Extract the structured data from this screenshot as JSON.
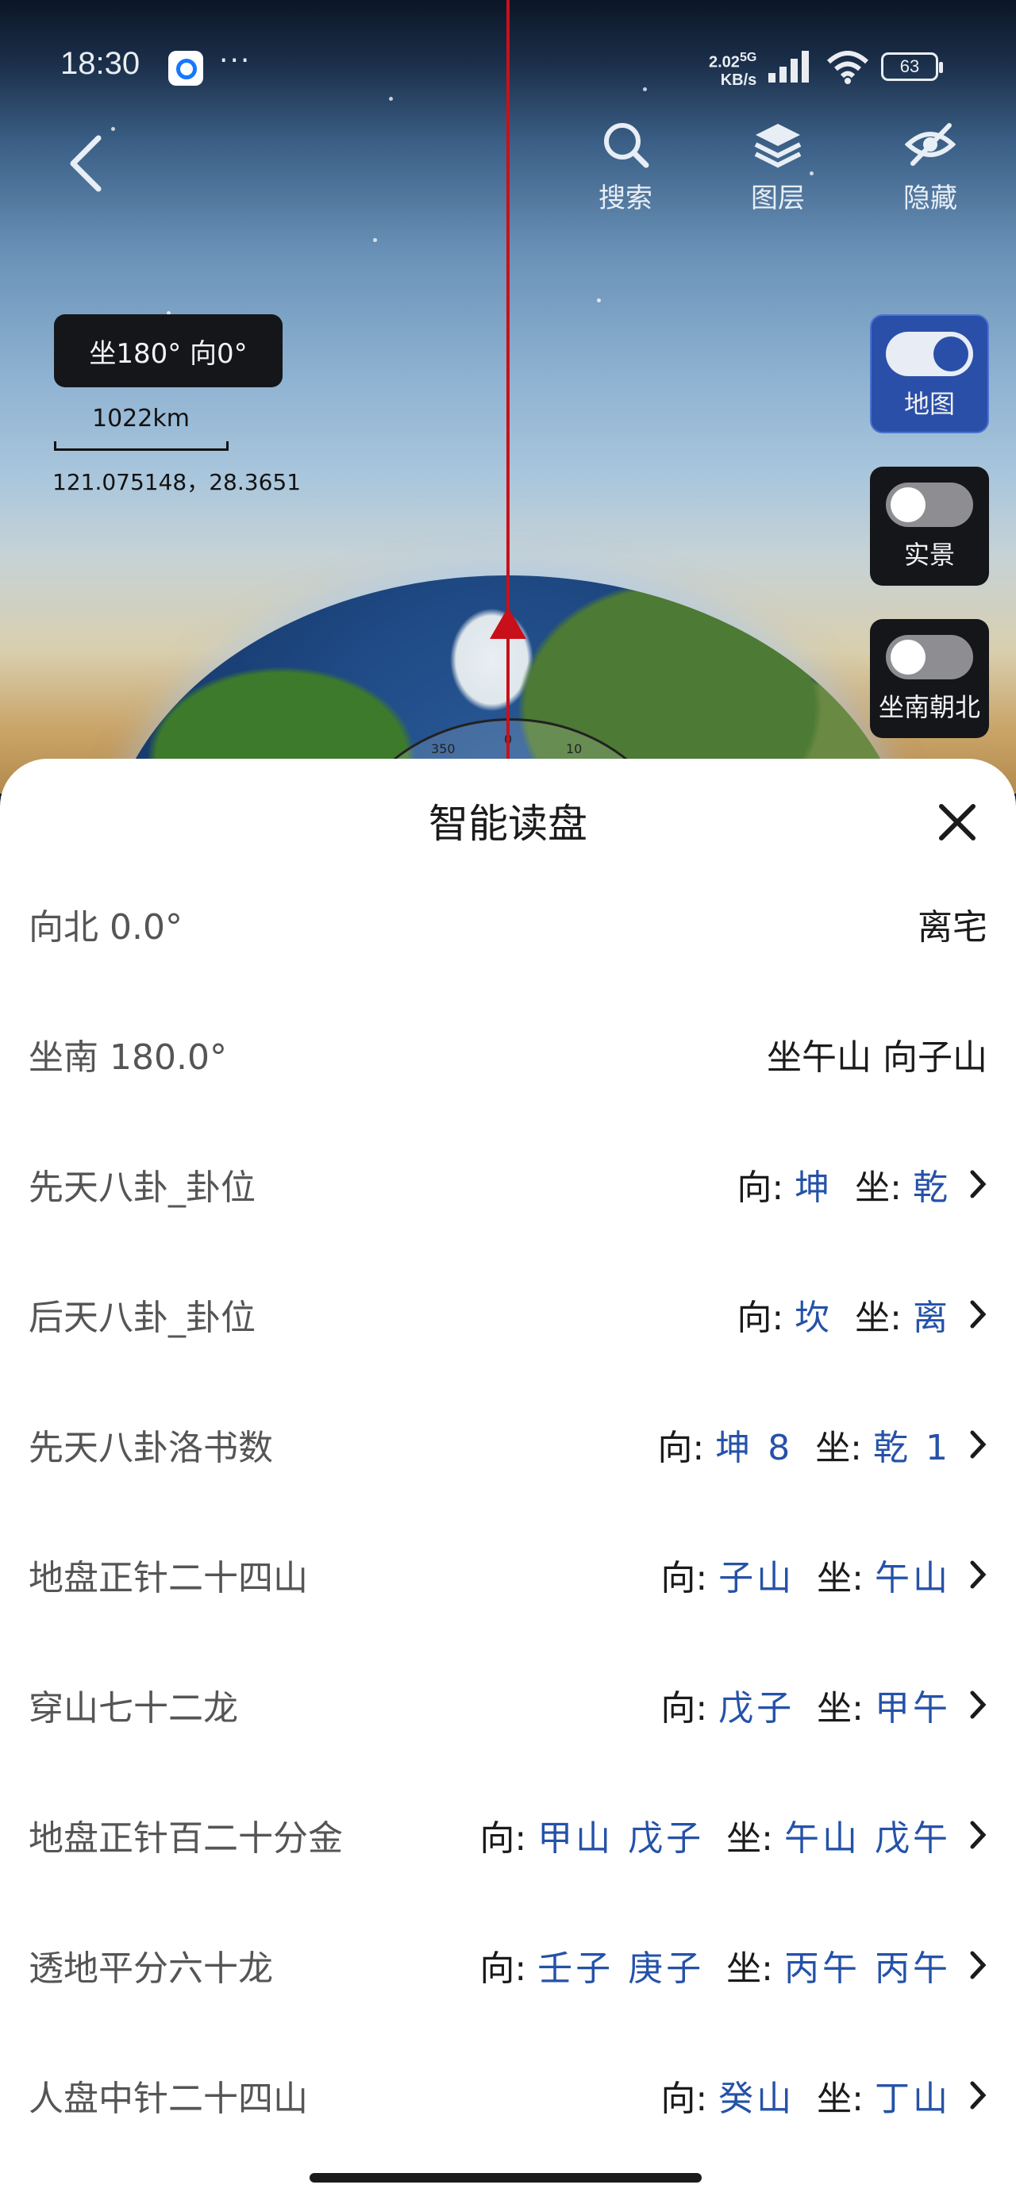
{
  "status_bar": {
    "time": "18:30",
    "net_speed_value": "2.02",
    "net_speed_unit": "KB/s",
    "network": "5G",
    "battery": "63"
  },
  "top_nav": {
    "search_label": "搜索",
    "layers_label": "图层",
    "hide_label": "隐藏"
  },
  "map_overlay": {
    "bearing": "坐180° 向0°",
    "scale": "1022km",
    "coords": "121.075148，28.3651",
    "compass_ticks": [
      "350",
      "0",
      "10"
    ]
  },
  "side_toggles": [
    {
      "label": "地图",
      "on": true
    },
    {
      "label": "实景",
      "on": false
    },
    {
      "label": "坐南朝北",
      "on": false
    }
  ],
  "sheet": {
    "title": "智能读盘",
    "info_rows": [
      {
        "label": "向北  0.0°",
        "value": "离宅"
      },
      {
        "label": "坐南  180.0°",
        "value": "坐午山 向子山"
      }
    ],
    "rows": [
      {
        "label": "先天八卦_卦位",
        "face_key": "向:",
        "face": "坤",
        "sit_key": "坐:",
        "sit": "乾"
      },
      {
        "label": "后天八卦_卦位",
        "face_key": "向:",
        "face": "坎",
        "sit_key": "坐:",
        "sit": "离"
      },
      {
        "label": "先天八卦洛书数",
        "face_key": "向:",
        "face": "坤 8",
        "sit_key": "坐:",
        "sit": "乾 1"
      },
      {
        "label": "地盘正针二十四山",
        "face_key": "向:",
        "face": "子山",
        "sit_key": "坐:",
        "sit": "午山"
      },
      {
        "label": "穿山七十二龙",
        "face_key": "向:",
        "face": "戊子",
        "sit_key": "坐:",
        "sit": "甲午"
      },
      {
        "label": "地盘正针百二十分金",
        "face_key": "向:",
        "face": "甲山 戊子",
        "sit_key": "坐:",
        "sit": "午山 戊午"
      },
      {
        "label": "透地平分六十龙",
        "face_key": "向:",
        "face": "壬子 庚子",
        "sit_key": "坐:",
        "sit": "丙午 丙午"
      },
      {
        "label": "人盘中针二十四山",
        "face_key": "向:",
        "face": "癸山",
        "sit_key": "坐:",
        "sit": "丁山"
      }
    ]
  },
  "colors": {
    "accent_blue": "#2552a8",
    "needle_red": "#c9101a",
    "toggle_active": "#2a4fa8"
  }
}
